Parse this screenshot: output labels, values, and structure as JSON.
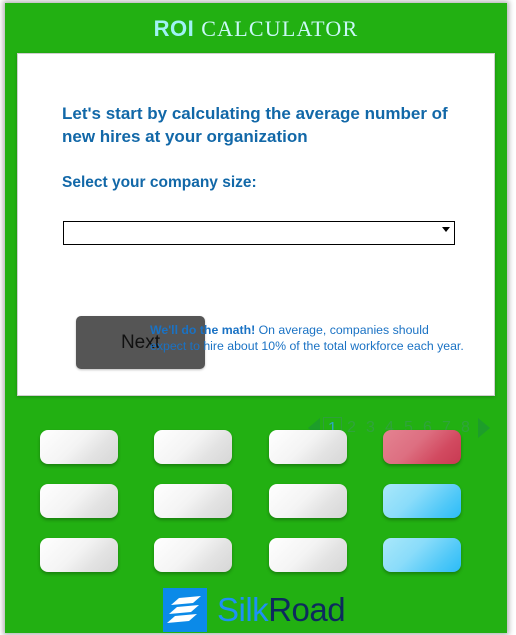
{
  "header": {
    "title_bold": "ROI",
    "title_rest": "CALCULATOR",
    "bold_color": "#9ff2f4",
    "rest_color": "#c9f8f6",
    "background_color": "#22b012"
  },
  "main": {
    "heading": "Let's start by calculating the average number of new hires at your organization",
    "sub_label": "Select your company size:",
    "heading_color": "#1268a8",
    "select": {
      "value": "",
      "placeholder": "",
      "arrow_icon": "chevron-down-icon",
      "options": []
    },
    "next_button": {
      "label": "Next",
      "background_color": "#555555",
      "text_color": "#111111"
    },
    "hint": {
      "bold_part": "We'll do the math!",
      "rest": " On average, companies should expect to hire about 10% of the total workforce each year.",
      "color": "#1a72c4"
    }
  },
  "pagination": {
    "prev_icon": "arrow-left-icon",
    "next_icon": "arrow-right-icon",
    "pages": [
      "1",
      "2",
      "3",
      "4",
      "5",
      "6",
      "7",
      "8"
    ],
    "current_page": "1",
    "color": "#30a43c",
    "current_color": "#2ea8bf"
  },
  "keypad": {
    "rows": [
      [
        {
          "label": "",
          "style": "light"
        },
        {
          "label": "",
          "style": "light"
        },
        {
          "label": "",
          "style": "light"
        },
        {
          "label": "",
          "style": "red"
        }
      ],
      [
        {
          "label": "",
          "style": "light"
        },
        {
          "label": "",
          "style": "light"
        },
        {
          "label": "",
          "style": "light"
        },
        {
          "label": "",
          "style": "cyan"
        }
      ],
      [
        {
          "label": "",
          "style": "light"
        },
        {
          "label": "",
          "style": "light"
        },
        {
          "label": "",
          "style": "light"
        },
        {
          "label": "",
          "style": "cyan"
        }
      ]
    ],
    "colors": {
      "light": "#f0f0f0",
      "red": "#d24a60",
      "cyan": "#4fc8f8"
    }
  },
  "footer": {
    "logo": {
      "mark_icon": "silkroad-bars-icon",
      "mark_background": "#0b8ae8",
      "word_first": "Silk",
      "word_second": "Road",
      "word_first_color": "#1e90f5",
      "word_second_color": "#0d2a5e"
    }
  }
}
